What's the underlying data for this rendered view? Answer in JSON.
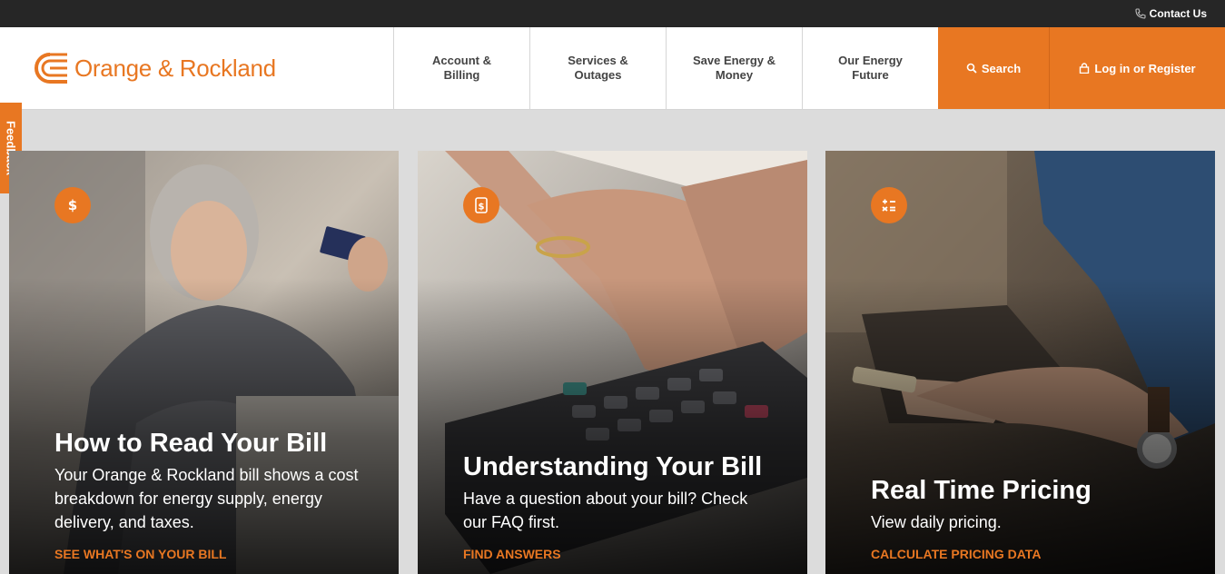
{
  "topbar": {
    "contact_label": "Contact Us"
  },
  "header": {
    "logo_text": "Orange & Rockland",
    "nav": [
      {
        "line1": "Account &",
        "line2": "Billing"
      },
      {
        "line1": "Services &",
        "line2": "Outages"
      },
      {
        "line1": "Save Energy &",
        "line2": "Money"
      },
      {
        "line1": "Our Energy",
        "line2": "Future"
      }
    ],
    "search_label": "Search",
    "login_label": "Log in or Register"
  },
  "feedback_label": "Feedback",
  "colors": {
    "brand_orange": "#e87722",
    "topbar": "#262626"
  },
  "cards": [
    {
      "icon": "dollar-icon",
      "title": "How to Read Your Bill",
      "description": "Your Orange & Rockland bill shows a cost breakdown for energy supply, energy delivery, and taxes.",
      "link": "SEE WHAT'S ON YOUR BILL"
    },
    {
      "icon": "bill-document-icon",
      "title": "Understanding Your Bill",
      "description": "Have a question about your bill? Check our FAQ first.",
      "link": "FIND ANSWERS"
    },
    {
      "icon": "calculator-icon",
      "title": "Real Time Pricing",
      "description": "View daily pricing.",
      "link": "CALCULATE PRICING DATA"
    }
  ]
}
